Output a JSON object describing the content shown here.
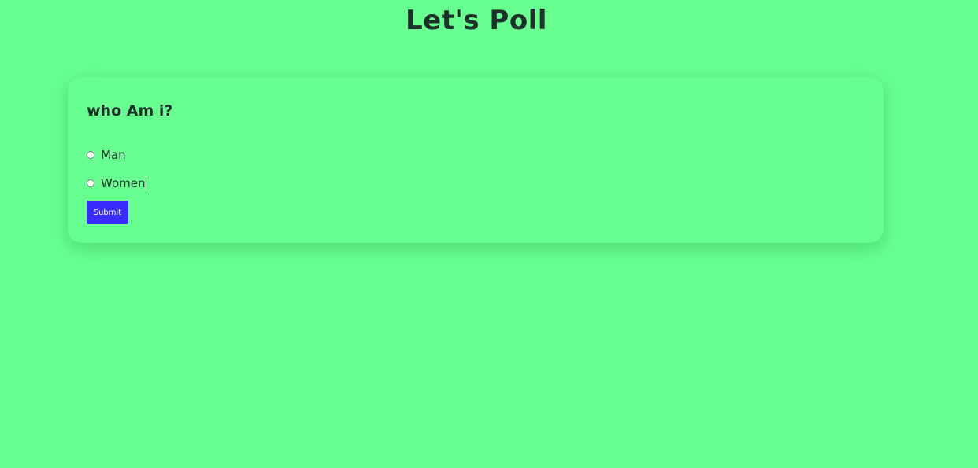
{
  "page": {
    "title": "Let's Poll",
    "background_color": "#66ff90"
  },
  "poll": {
    "question": "who Am i?",
    "options": [
      {
        "label": "Man",
        "selected": false
      },
      {
        "label": "Women",
        "selected": false
      }
    ],
    "submit_label": "Submit",
    "submit_color": "#3a2cff"
  }
}
